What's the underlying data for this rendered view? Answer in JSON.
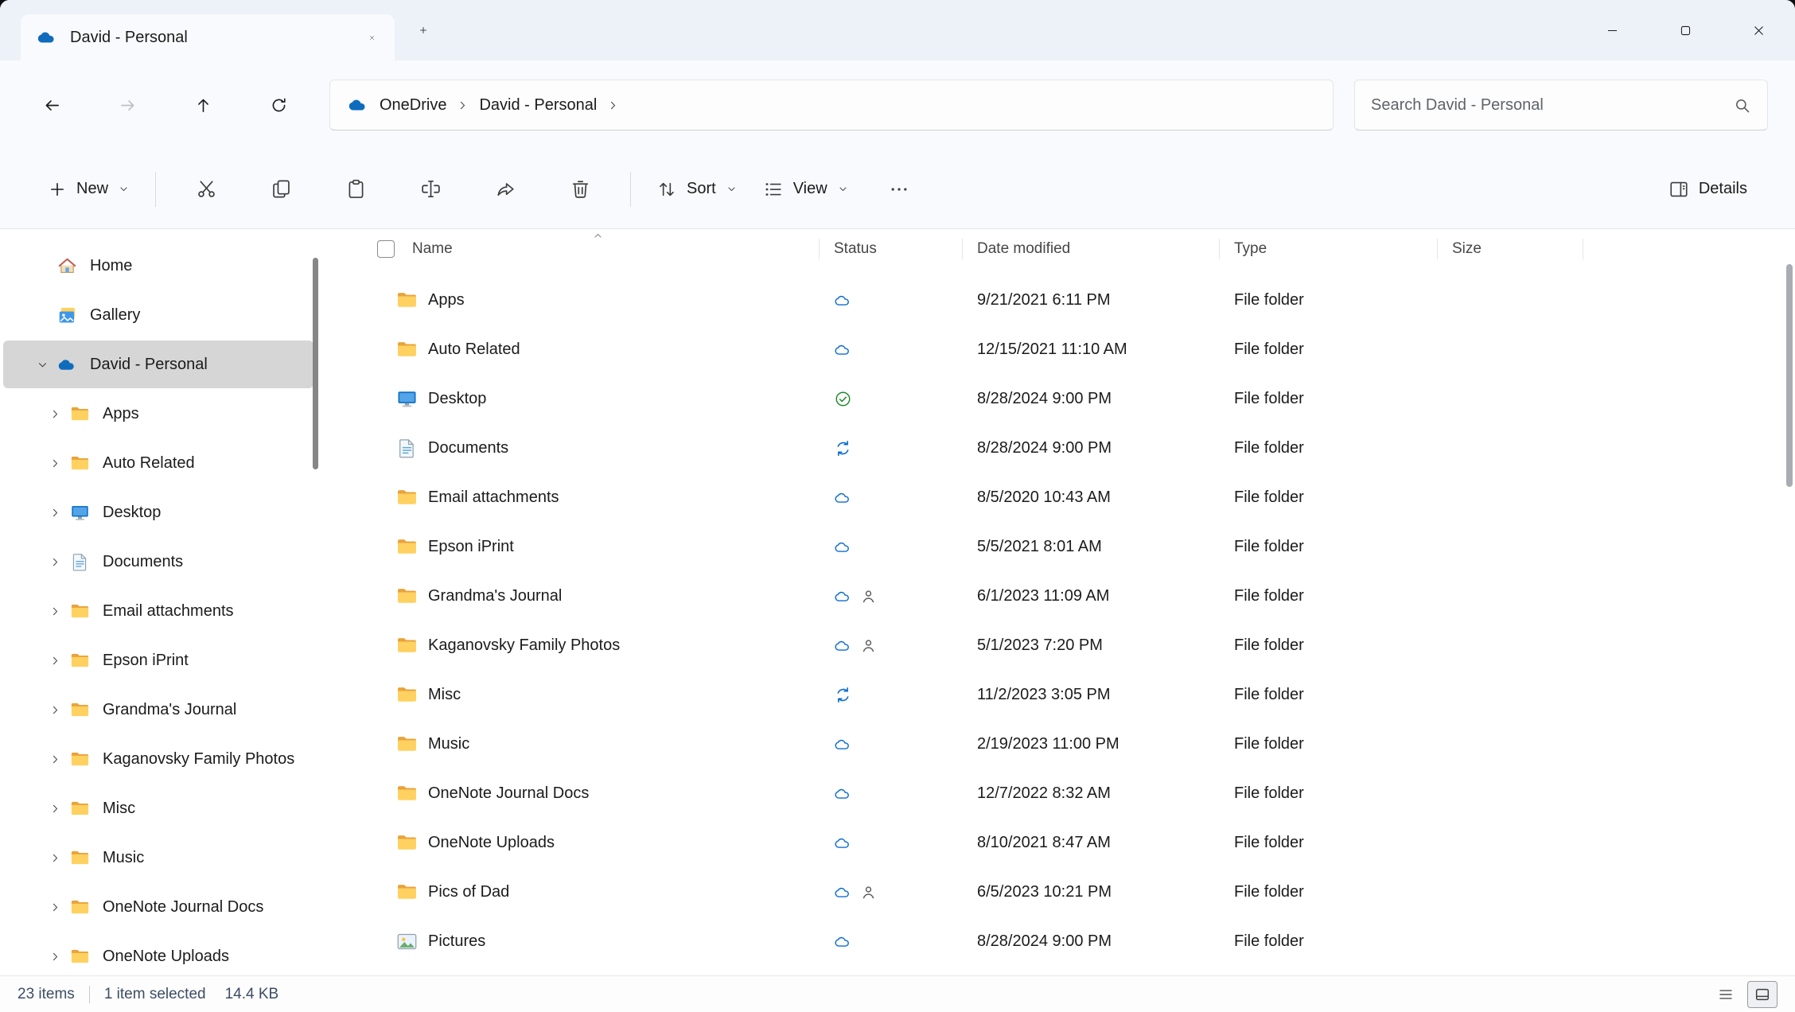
{
  "tab": {
    "title": "David - Personal"
  },
  "navigation": {
    "breadcrumbs": [
      "OneDrive",
      "David - Personal"
    ],
    "search_placeholder": "Search David - Personal"
  },
  "toolbar": {
    "new_label": "New",
    "sort_label": "Sort",
    "view_label": "View",
    "details_label": "Details"
  },
  "sidebar": {
    "items": [
      {
        "label": "Home",
        "icon": "home",
        "level": 0,
        "chevron": null,
        "selected": false
      },
      {
        "label": "Gallery",
        "icon": "gallery",
        "level": 0,
        "chevron": null,
        "selected": false
      },
      {
        "label": "David - Personal",
        "icon": "onedrive",
        "level": 0,
        "chevron": "down",
        "selected": true
      },
      {
        "label": "Apps",
        "icon": "folder",
        "level": 1,
        "chevron": "right",
        "selected": false
      },
      {
        "label": "Auto Related",
        "icon": "folder",
        "level": 1,
        "chevron": "right",
        "selected": false
      },
      {
        "label": "Desktop",
        "icon": "desktop",
        "level": 1,
        "chevron": "right",
        "selected": false
      },
      {
        "label": "Documents",
        "icon": "documents",
        "level": 1,
        "chevron": "right",
        "selected": false
      },
      {
        "label": "Email attachments",
        "icon": "folder",
        "level": 1,
        "chevron": "right",
        "selected": false
      },
      {
        "label": "Epson iPrint",
        "icon": "folder",
        "level": 1,
        "chevron": "right",
        "selected": false
      },
      {
        "label": "Grandma's Journal",
        "icon": "folder",
        "level": 1,
        "chevron": "right",
        "selected": false
      },
      {
        "label": "Kaganovsky Family Photos",
        "icon": "folder",
        "level": 1,
        "chevron": "right",
        "selected": false
      },
      {
        "label": "Misc",
        "icon": "folder",
        "level": 1,
        "chevron": "right",
        "selected": false
      },
      {
        "label": "Music",
        "icon": "folder",
        "level": 1,
        "chevron": "right",
        "selected": false
      },
      {
        "label": "OneNote Journal Docs",
        "icon": "folder",
        "level": 1,
        "chevron": "right",
        "selected": false
      },
      {
        "label": "OneNote Uploads",
        "icon": "folder",
        "level": 1,
        "chevron": "right",
        "selected": false
      }
    ]
  },
  "table": {
    "columns": [
      "Name",
      "Status",
      "Date modified",
      "Type",
      "Size"
    ],
    "rows": [
      {
        "name": "Apps",
        "icon": "folder",
        "status": [
          "cloud"
        ],
        "date_modified": "9/21/2021 6:11 PM",
        "type": "File folder",
        "size": ""
      },
      {
        "name": "Auto Related",
        "icon": "folder",
        "status": [
          "cloud"
        ],
        "date_modified": "12/15/2021 11:10 AM",
        "type": "File folder",
        "size": ""
      },
      {
        "name": "Desktop",
        "icon": "desktop",
        "status": [
          "synced"
        ],
        "date_modified": "8/28/2024 9:00 PM",
        "type": "File folder",
        "size": ""
      },
      {
        "name": "Documents",
        "icon": "documents",
        "status": [
          "syncing"
        ],
        "date_modified": "8/28/2024 9:00 PM",
        "type": "File folder",
        "size": ""
      },
      {
        "name": "Email attachments",
        "icon": "folder",
        "status": [
          "cloud"
        ],
        "date_modified": "8/5/2020 10:43 AM",
        "type": "File folder",
        "size": ""
      },
      {
        "name": "Epson iPrint",
        "icon": "folder",
        "status": [
          "cloud"
        ],
        "date_modified": "5/5/2021 8:01 AM",
        "type": "File folder",
        "size": ""
      },
      {
        "name": "Grandma's Journal",
        "icon": "folder",
        "status": [
          "cloud",
          "shared"
        ],
        "date_modified": "6/1/2023 11:09 AM",
        "type": "File folder",
        "size": ""
      },
      {
        "name": "Kaganovsky Family Photos",
        "icon": "folder",
        "status": [
          "cloud",
          "shared"
        ],
        "date_modified": "5/1/2023 7:20 PM",
        "type": "File folder",
        "size": ""
      },
      {
        "name": "Misc",
        "icon": "folder",
        "status": [
          "syncing"
        ],
        "date_modified": "11/2/2023 3:05 PM",
        "type": "File folder",
        "size": ""
      },
      {
        "name": "Music",
        "icon": "folder",
        "status": [
          "cloud"
        ],
        "date_modified": "2/19/2023 11:00 PM",
        "type": "File folder",
        "size": ""
      },
      {
        "name": "OneNote Journal Docs",
        "icon": "folder",
        "status": [
          "cloud"
        ],
        "date_modified": "12/7/2022 8:32 AM",
        "type": "File folder",
        "size": ""
      },
      {
        "name": "OneNote Uploads",
        "icon": "folder",
        "status": [
          "cloud"
        ],
        "date_modified": "8/10/2021 8:47 AM",
        "type": "File folder",
        "size": ""
      },
      {
        "name": "Pics of Dad",
        "icon": "folder",
        "status": [
          "cloud",
          "shared"
        ],
        "date_modified": "6/5/2023 10:21 PM",
        "type": "File folder",
        "size": ""
      },
      {
        "name": "Pictures",
        "icon": "pictures",
        "status": [
          "cloud"
        ],
        "date_modified": "8/28/2024 9:00 PM",
        "type": "File folder",
        "size": ""
      }
    ]
  },
  "status_bar": {
    "item_count": "23 items",
    "selection": "1 item selected",
    "selection_size": "14.4 KB"
  }
}
